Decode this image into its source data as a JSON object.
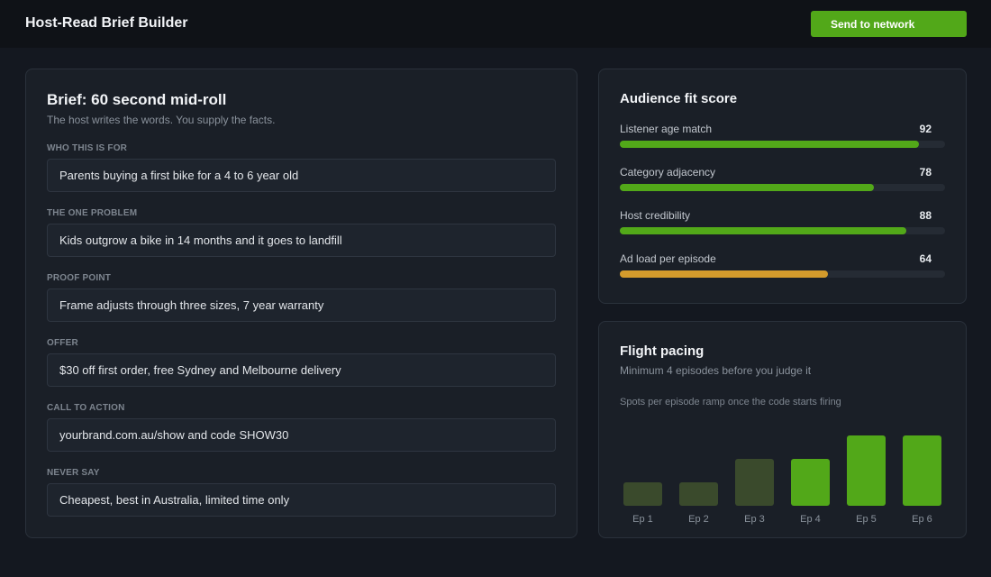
{
  "app": {
    "title": "Host-Read Brief Builder",
    "send_label": "Send to network"
  },
  "brief": {
    "title": "Brief: 60 second mid-roll",
    "subtitle": "The host writes the words. You supply the facts.",
    "fields": [
      {
        "label": "WHO THIS IS FOR",
        "value": "Parents buying a first bike for a 4 to 6 year old"
      },
      {
        "label": "THE ONE PROBLEM",
        "value": "Kids outgrow a bike in 14 months and it goes to landfill"
      },
      {
        "label": "PROOF POINT",
        "value": "Frame adjusts through three sizes, 7 year warranty"
      },
      {
        "label": "OFFER",
        "value": "$30 off first order, free Sydney and Melbourne delivery"
      },
      {
        "label": "CALL TO ACTION",
        "value": "yourbrand.com.au/show and code SHOW30"
      },
      {
        "label": "NEVER SAY",
        "value": "Cheapest, best in Australia, limited time only"
      }
    ]
  },
  "fit": {
    "title": "Audience fit score",
    "max": 100,
    "scores": [
      {
        "label": "Listener age match",
        "value": "92",
        "percent": 92,
        "color": "#52a819"
      },
      {
        "label": "Category adjacency",
        "value": "78",
        "percent": 78,
        "color": "#52a819"
      },
      {
        "label": "Host credibility",
        "value": "88",
        "percent": 88,
        "color": "#52a819"
      },
      {
        "label": "Ad load per episode",
        "value": "64",
        "percent": 64,
        "color": "#d49b2c"
      }
    ]
  },
  "pacing": {
    "title": "Flight pacing",
    "subtitle": "Minimum 4 episodes before you judge it",
    "note": "Spots per episode ramp once the code starts firing",
    "chart_data": {
      "type": "bar",
      "categories": [
        "Ep 1",
        "Ep 2",
        "Ep 3",
        "Ep 4",
        "Ep 5",
        "Ep 6"
      ],
      "values": [
        1,
        1,
        2,
        2,
        3,
        3
      ],
      "ylim": [
        0,
        3
      ],
      "colors": [
        "#3a4a2c",
        "#3a4a2c",
        "#3a4a2c",
        "#52a819",
        "#52a819",
        "#52a819"
      ]
    }
  }
}
